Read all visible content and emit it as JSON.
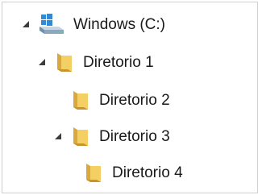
{
  "tree": {
    "nodes": [
      {
        "id": "windows-c",
        "label": "Windows (C:)",
        "icon": "drive-icon",
        "expanded": true,
        "level": 0
      },
      {
        "id": "diretorio-1",
        "label": "Diretorio 1",
        "icon": "folder-icon",
        "expanded": true,
        "level": 1
      },
      {
        "id": "diretorio-2",
        "label": "Diretorio 2",
        "icon": "folder-icon",
        "expanded": false,
        "level": 2
      },
      {
        "id": "diretorio-3",
        "label": "Diretorio 3",
        "icon": "folder-icon",
        "expanded": true,
        "level": 2
      },
      {
        "id": "diretorio-4",
        "label": "Diretorio 4",
        "icon": "folder-icon",
        "expanded": false,
        "level": 3
      }
    ]
  },
  "colors": {
    "folder_back": "#d9a93b",
    "folder_front": "#f4cf63",
    "expander": "#3c3c3c",
    "drive_blue": "#2f8bd8",
    "drive_body": "#8aa8c4"
  }
}
